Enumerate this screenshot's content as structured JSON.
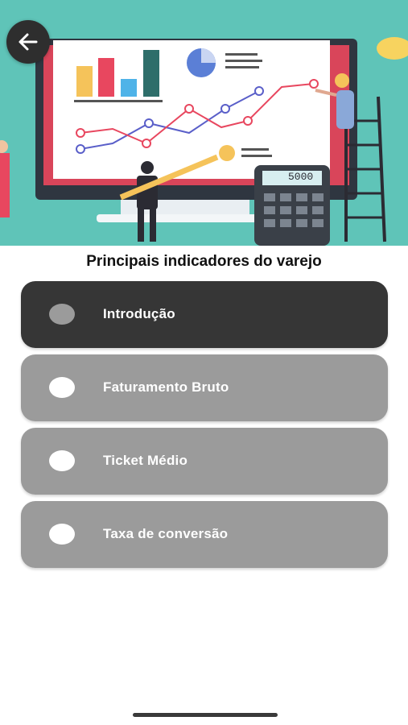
{
  "header": {
    "back_icon": "arrow-left-icon",
    "hero_calculator_display": "5000"
  },
  "page": {
    "title": "Principais indicadores do varejo"
  },
  "lessons": [
    {
      "label": "Introdução",
      "active": true
    },
    {
      "label": "Faturamento Bruto",
      "active": false
    },
    {
      "label": "Ticket Médio",
      "active": false
    },
    {
      "label": "Taxa de conversão",
      "active": false
    }
  ],
  "colors": {
    "active_item": "#363636",
    "inactive_item": "#9b9b9b",
    "hero_background": "#5fc4b8"
  }
}
